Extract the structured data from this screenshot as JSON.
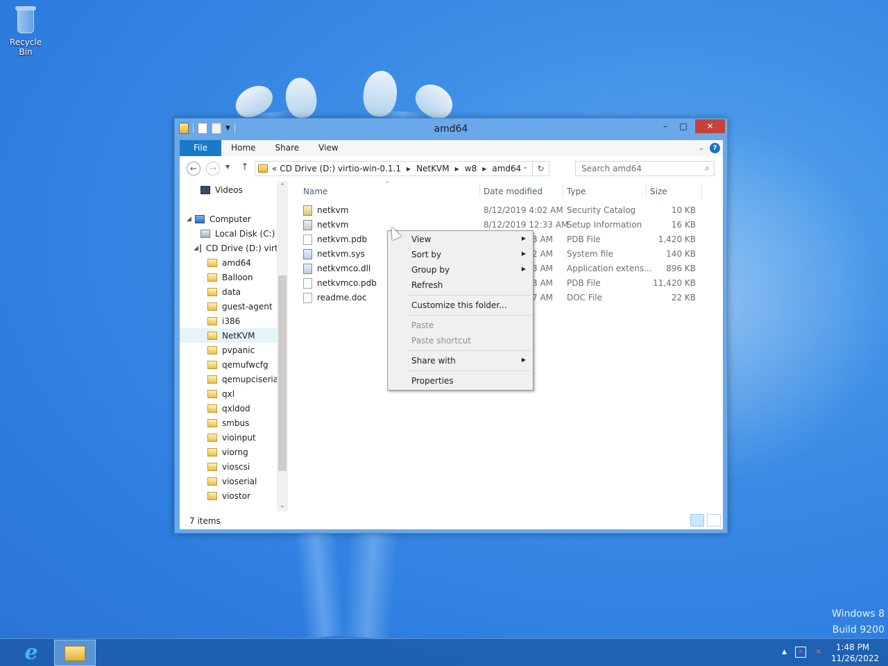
{
  "desktop": {
    "icons": [
      {
        "label": "Recycle Bin",
        "icon": "recycle-bin-icon"
      }
    ],
    "watermark": {
      "line1": "Windows 8",
      "line2": "Build 9200"
    }
  },
  "window": {
    "title": "amd64",
    "controls": {
      "minimize": "–",
      "maximize": "□",
      "close": "✕"
    },
    "ribbon": {
      "tabs": [
        "File",
        "Home",
        "Share",
        "View"
      ],
      "expand_glyph": "⌄",
      "help_glyph": "?"
    },
    "nav": {
      "back": "←",
      "forward": "→",
      "recent": "▼",
      "up": "↑",
      "address": {
        "prefix": "«",
        "crumbs": [
          "CD Drive (D:) virtio-win-0.1.1",
          "NetKVM",
          "w8",
          "amd64"
        ],
        "separator": "▶",
        "dropdown": "⌄",
        "refresh": "↻"
      },
      "search_placeholder": "Search amd64",
      "search_glyph": "⌕"
    },
    "tree": {
      "items": [
        {
          "label": "Videos",
          "icon": "videos-icon"
        },
        {
          "label": "Computer",
          "icon": "computer-icon"
        },
        {
          "label": "Local Disk (C:)",
          "icon": "local-disk-icon"
        },
        {
          "label": "CD Drive (D:) virt",
          "icon": "cd-drive-icon"
        },
        {
          "label": "amd64",
          "icon": "folder-icon"
        },
        {
          "label": "Balloon",
          "icon": "folder-icon"
        },
        {
          "label": "data",
          "icon": "folder-icon"
        },
        {
          "label": "guest-agent",
          "icon": "folder-icon"
        },
        {
          "label": "i386",
          "icon": "folder-icon"
        },
        {
          "label": "NetKVM",
          "icon": "folder-icon",
          "selected": true
        },
        {
          "label": "pvpanic",
          "icon": "folder-icon"
        },
        {
          "label": "qemufwcfg",
          "icon": "folder-icon"
        },
        {
          "label": "qemupciserial",
          "icon": "folder-icon"
        },
        {
          "label": "qxl",
          "icon": "folder-icon"
        },
        {
          "label": "qxldod",
          "icon": "folder-icon"
        },
        {
          "label": "smbus",
          "icon": "folder-icon"
        },
        {
          "label": "vioinput",
          "icon": "folder-icon"
        },
        {
          "label": "viorng",
          "icon": "folder-icon"
        },
        {
          "label": "vioscsi",
          "icon": "folder-icon"
        },
        {
          "label": "vioserial",
          "icon": "folder-icon"
        },
        {
          "label": "viostor",
          "icon": "folder-icon"
        }
      ],
      "scroll_up": "⌃",
      "scroll_down": "⌄"
    },
    "files": {
      "columns": [
        "Name",
        "Date modified",
        "Type",
        "Size"
      ],
      "sort_glyph": "^",
      "rows": [
        {
          "name": "netkvm",
          "date": "8/12/2019 4:02 AM",
          "type": "Security Catalog",
          "size": "10 KB",
          "icon": "catalog-file-icon"
        },
        {
          "name": "netkvm",
          "date": "8/12/2019 12:33 AM",
          "type": "Setup Information",
          "size": "16 KB",
          "icon": "setup-info-file-icon"
        },
        {
          "name": "netkvm.pdb",
          "date": "3 AM",
          "type": "PDB File",
          "size": "1,420 KB",
          "icon": "pdb-file-icon"
        },
        {
          "name": "netkvm.sys",
          "date": "2 AM",
          "type": "System file",
          "size": "140 KB",
          "icon": "system-file-icon"
        },
        {
          "name": "netkvmco.dll",
          "date": "3 AM",
          "type": "Application extens...",
          "size": "896 KB",
          "icon": "dll-file-icon"
        },
        {
          "name": "netkvmco.pdb",
          "date": "3 AM",
          "type": "PDB File",
          "size": "11,420 KB",
          "icon": "pdb-file-icon"
        },
        {
          "name": "readme.doc",
          "date": "7 AM",
          "type": "DOC File",
          "size": "22 KB",
          "icon": "doc-file-icon"
        }
      ]
    },
    "status": {
      "item_count": "7 items"
    }
  },
  "context_menu": {
    "items": [
      {
        "label": "View",
        "submenu": true,
        "disabled": false
      },
      {
        "label": "Sort by",
        "submenu": true,
        "disabled": false
      },
      {
        "label": "Group by",
        "submenu": true,
        "disabled": false
      },
      {
        "label": "Refresh",
        "submenu": false,
        "disabled": false
      },
      {
        "label": "Customize this folder...",
        "submenu": false,
        "disabled": false
      },
      {
        "label": "Paste",
        "submenu": false,
        "disabled": true
      },
      {
        "label": "Paste shortcut",
        "submenu": false,
        "disabled": true
      },
      {
        "label": "Share with",
        "submenu": true,
        "disabled": false
      },
      {
        "label": "Properties",
        "submenu": false,
        "disabled": false
      }
    ],
    "submenu_glyph": "▶"
  },
  "taskbar": {
    "apps": [
      {
        "name": "Internet Explorer",
        "icon": "internet-explorer-icon",
        "glyph": "e"
      },
      {
        "name": "File Explorer",
        "icon": "file-explorer-icon",
        "active": true
      }
    ],
    "tray": {
      "show_hidden_glyph": "▲",
      "network_glyph": "✕",
      "volume_glyph": "✕",
      "time": "1:48 PM",
      "date": "11/26/2022"
    }
  },
  "colors": {
    "desktop_blue": "#2e7fe0",
    "window_frame": "#6aa8ea",
    "file_tab": "#1979ca",
    "close_button": "#c7413a",
    "selection": "#e5f3fb"
  }
}
